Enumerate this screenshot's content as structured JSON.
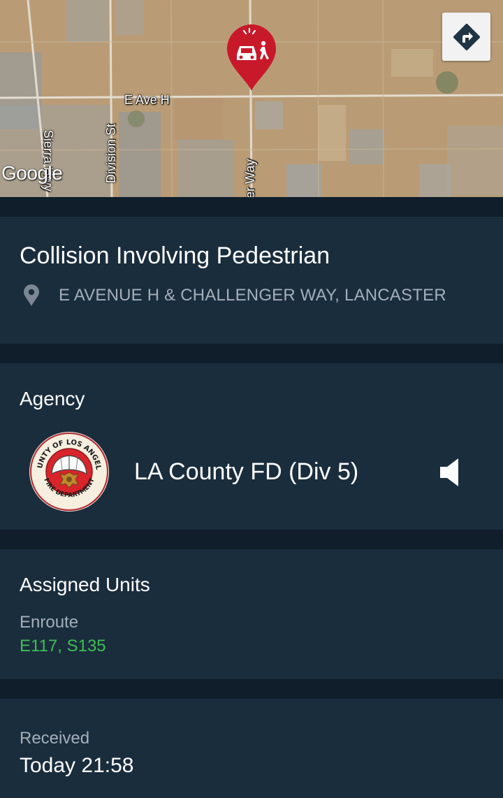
{
  "map": {
    "roads": {
      "e_ave_h": "E Ave H",
      "division_st": "Division St",
      "sierra_hwy": "Sierra Hwy",
      "challenger_way": "er Way"
    },
    "attribution": "Google",
    "incident_marker_icon": "car-pedestrian-collision-icon",
    "directions_icon": "directions-turn-right-icon"
  },
  "incident": {
    "title": "Collision Involving Pedestrian",
    "address": "E AVENUE H & CHALLENGER WAY, LANCASTER",
    "location_icon": "map-pin-icon"
  },
  "agency": {
    "label": "Agency",
    "name": "LA County FD (Div 5)",
    "seal_text_top": "COUNTY OF LOS ANGELES",
    "seal_text_bottom": "FIRE DEPARTMENT",
    "audio_icon": "speaker-icon"
  },
  "units": {
    "label": "Assigned Units",
    "status": "Enroute",
    "list": "E117, S135"
  },
  "received": {
    "label": "Received",
    "value": "Today 21:58"
  },
  "colors": {
    "background": "#142635",
    "card": "#1a2d3d",
    "muted_text": "#a4afb9",
    "enroute_green": "#3fbf54",
    "marker_red": "#c8192b"
  }
}
